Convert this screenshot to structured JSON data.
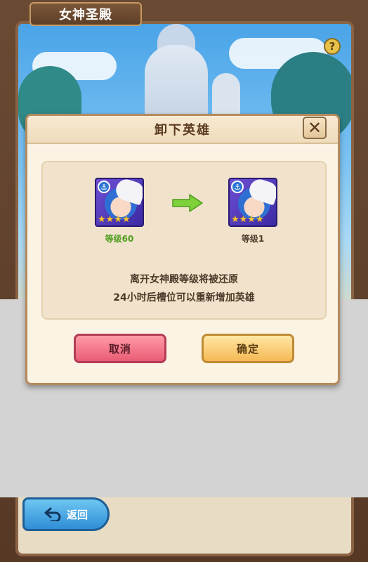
{
  "screen": {
    "title": "女神圣殿",
    "help_label": "?"
  },
  "dialog": {
    "title": "卸下英雄",
    "close_label": "✕",
    "hero_before": {
      "level_label": "等级60",
      "stars": "★★★★",
      "badge": "⚓"
    },
    "hero_after": {
      "level_label": "等级1",
      "stars": "★★★★",
      "badge": "⚓"
    },
    "info_line1": "离开女神殿等级将被还原",
    "info_line2": "24小时后槽位可以重新增加英雄",
    "cancel_label": "取消",
    "confirm_label": "确定"
  },
  "footer": {
    "back_label": "返回"
  },
  "colors": {
    "level_before": "#4f9d1f",
    "level_after": "#4a3a2a",
    "arrow": "#7ed13a"
  },
  "icons": [
    "help-icon",
    "close-icon",
    "anchor-icon",
    "arrow-right-icon",
    "lock-icon",
    "back-arrow-icon"
  ]
}
